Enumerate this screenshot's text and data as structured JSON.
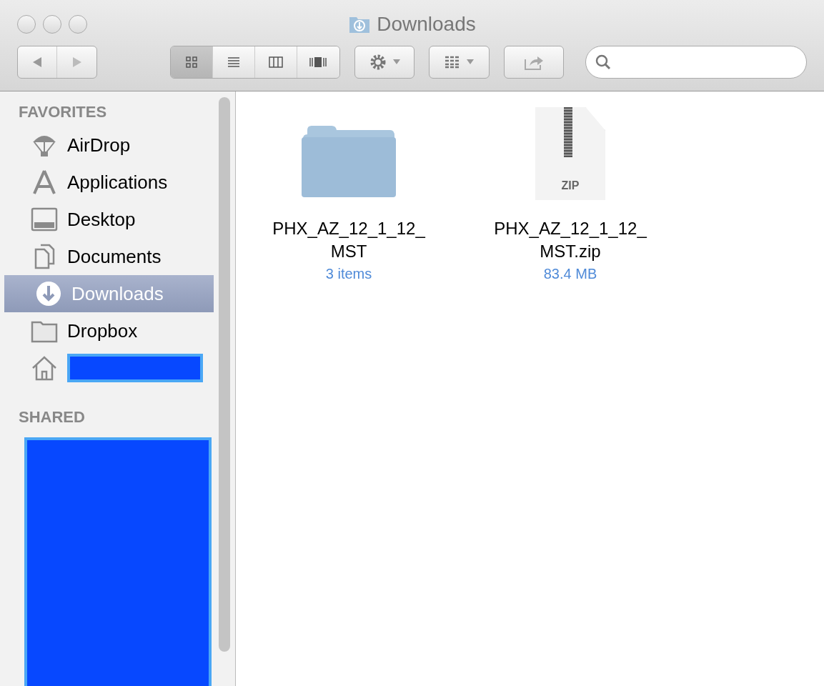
{
  "window": {
    "title": "Downloads"
  },
  "toolbar": {
    "view_buttons": [
      {
        "kind": "icon",
        "selected": true
      },
      {
        "kind": "list",
        "selected": false
      },
      {
        "kind": "columns",
        "selected": false
      },
      {
        "kind": "coverflow",
        "selected": false
      }
    ]
  },
  "sidebar": {
    "sections": [
      {
        "title": "FAVORITES",
        "items": [
          {
            "label": "AirDrop",
            "kind": "airdrop",
            "selected": false
          },
          {
            "label": "Applications",
            "kind": "applications",
            "selected": false
          },
          {
            "label": "Desktop",
            "kind": "desktop",
            "selected": false
          },
          {
            "label": "Documents",
            "kind": "documents",
            "selected": false
          },
          {
            "label": "Downloads",
            "kind": "downloads",
            "selected": true
          },
          {
            "label": "Dropbox",
            "kind": "folder",
            "selected": false
          },
          {
            "kind": "home",
            "redacted": true,
            "selected": false
          }
        ]
      },
      {
        "title": "SHARED",
        "redacted": true
      }
    ]
  },
  "files": [
    {
      "kind": "folder",
      "name_lines": [
        "PHX_AZ_12_1_12_",
        "MST"
      ],
      "info": "3 items"
    },
    {
      "kind": "zip",
      "name_lines": [
        "PHX_AZ_12_1_12_",
        "MST.zip"
      ],
      "info": "83.4 MB",
      "badge": "ZIP"
    }
  ]
}
